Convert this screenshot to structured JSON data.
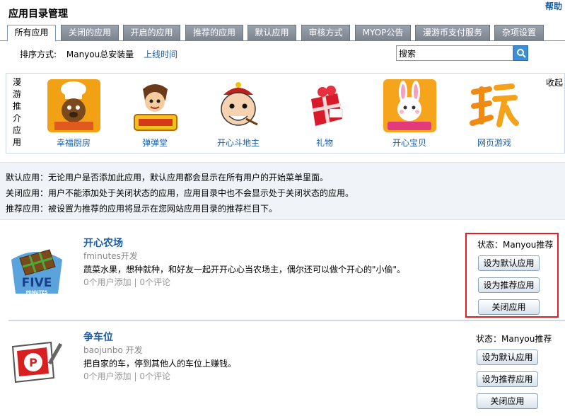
{
  "page": {
    "title": "应用目录管理",
    "help": "帮助"
  },
  "tabs": [
    {
      "label": "所有应用",
      "active": true
    },
    {
      "label": "关闭的应用"
    },
    {
      "label": "开启的应用"
    },
    {
      "label": "推荐的应用"
    },
    {
      "label": "默认应用"
    },
    {
      "label": "审核方式"
    },
    {
      "label": "MYOP公告"
    },
    {
      "label": "漫游币支付服务"
    },
    {
      "label": "杂项设置"
    }
  ],
  "sort": {
    "label": "排序方式:",
    "option_installs": "Manyou总安装量",
    "option_time": "上线时间"
  },
  "search": {
    "value": "搜索"
  },
  "recommended": {
    "title": "漫游推介应用",
    "collapse": "收起",
    "items": [
      {
        "label": "幸福厨房",
        "icon": "chef-dog-icon"
      },
      {
        "label": "弹弹堂",
        "icon": "ddtank-icon"
      },
      {
        "label": "开心斗地主",
        "icon": "landlord-face-icon"
      },
      {
        "label": "礼物",
        "icon": "gift-box-icon"
      },
      {
        "label": "开心宝贝",
        "icon": "bunny-icon"
      },
      {
        "label": "网页游戏",
        "icon": "play-glyph-icon"
      }
    ]
  },
  "descriptions": [
    "默认应用：无论用户是否添加此应用，默认应用都会显示在所有用户的开始菜单里面。",
    "关闭应用：用户不能添加处于关闭状态的应用，应用目录中也不会显示处于关闭状态的应用。",
    "推荐应用：被设置为推荐的应用将显示在您网站应用目录的推荐栏目下。"
  ],
  "apps": [
    {
      "name": "开心农场",
      "developer": "fminutes开发",
      "description": "蔬菜水果，想种就种，和好友一起开开心心当农场主，偶尔还可以做个开心的\"小偷\"。",
      "users": "0个用户添加",
      "comments": "0个评论",
      "status": "状态：Manyou推荐",
      "btn_default": "设为默认应用",
      "btn_recommend": "设为推荐应用",
      "btn_close": "关闭应用",
      "icon": "five-minutes-farm-icon",
      "icon_text": "FIVE",
      "icon_subtext": "MINUTES"
    },
    {
      "name": "争车位",
      "developer": "baojunbo 开发",
      "description": "把自家的车，停到其他人的车位上赚钱。",
      "users": "0个用户添加",
      "comments": "0个评论",
      "status": "状态：Manyou推荐",
      "btn_default": "设为默认应用",
      "btn_recommend": "设为推荐应用",
      "btn_close": "关闭应用",
      "icon": "parking-sign-icon",
      "icon_text": "P"
    }
  ]
}
